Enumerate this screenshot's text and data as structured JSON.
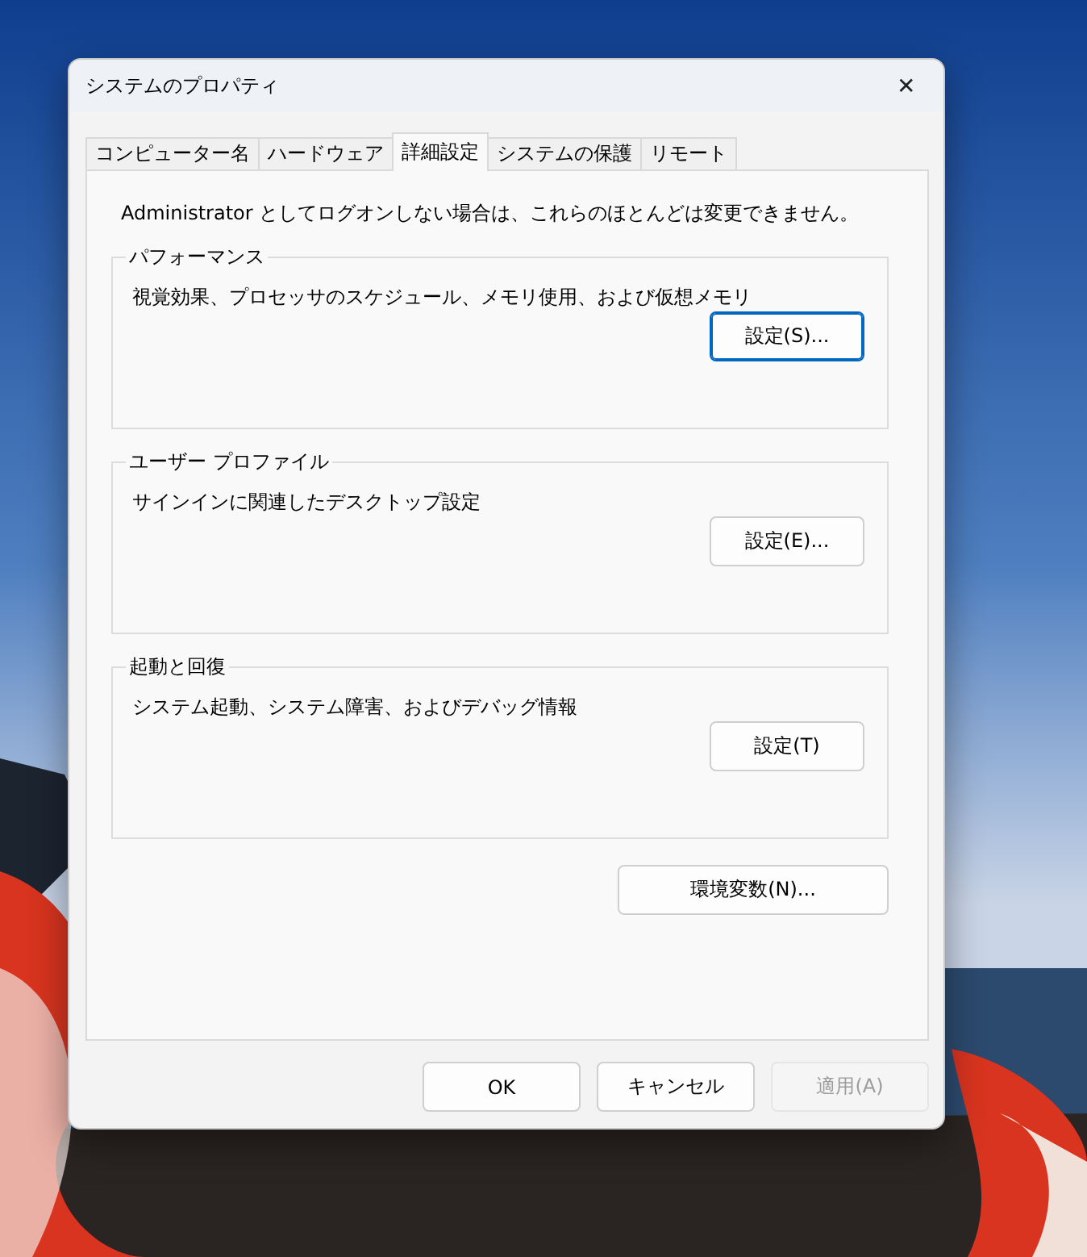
{
  "window": {
    "title": "システムのプロパティ",
    "close": "✕"
  },
  "tabs": [
    {
      "label": "コンピューター名",
      "selected": false
    },
    {
      "label": "ハードウェア",
      "selected": false
    },
    {
      "label": "詳細設定",
      "selected": true
    },
    {
      "label": "システムの保護",
      "selected": false
    },
    {
      "label": "リモート",
      "selected": false
    }
  ],
  "notice": "Administrator としてログオンしない場合は、これらのほとんどは変更できません。",
  "groups": [
    {
      "title": "パフォーマンス",
      "description": "視覚効果、プロセッサのスケジュール、メモリ使用、および仮想メモリ",
      "button": {
        "label": "設定(S)...",
        "focused": true
      }
    },
    {
      "title": "ユーザー プロファイル",
      "description": "サインインに関連したデスクトップ設定",
      "button": {
        "label": "設定(E)...",
        "focused": false
      }
    },
    {
      "title": "起動と回復",
      "description": "システム起動、システム障害、およびデバッグ情報",
      "button": {
        "label": "設定(T)",
        "focused": false
      }
    }
  ],
  "env_button": "環境変数(N)...",
  "buttons": [
    {
      "label": "OK",
      "disabled": false
    },
    {
      "label": "キャンセル",
      "disabled": false
    },
    {
      "label": "適用(A)",
      "disabled": true
    }
  ]
}
